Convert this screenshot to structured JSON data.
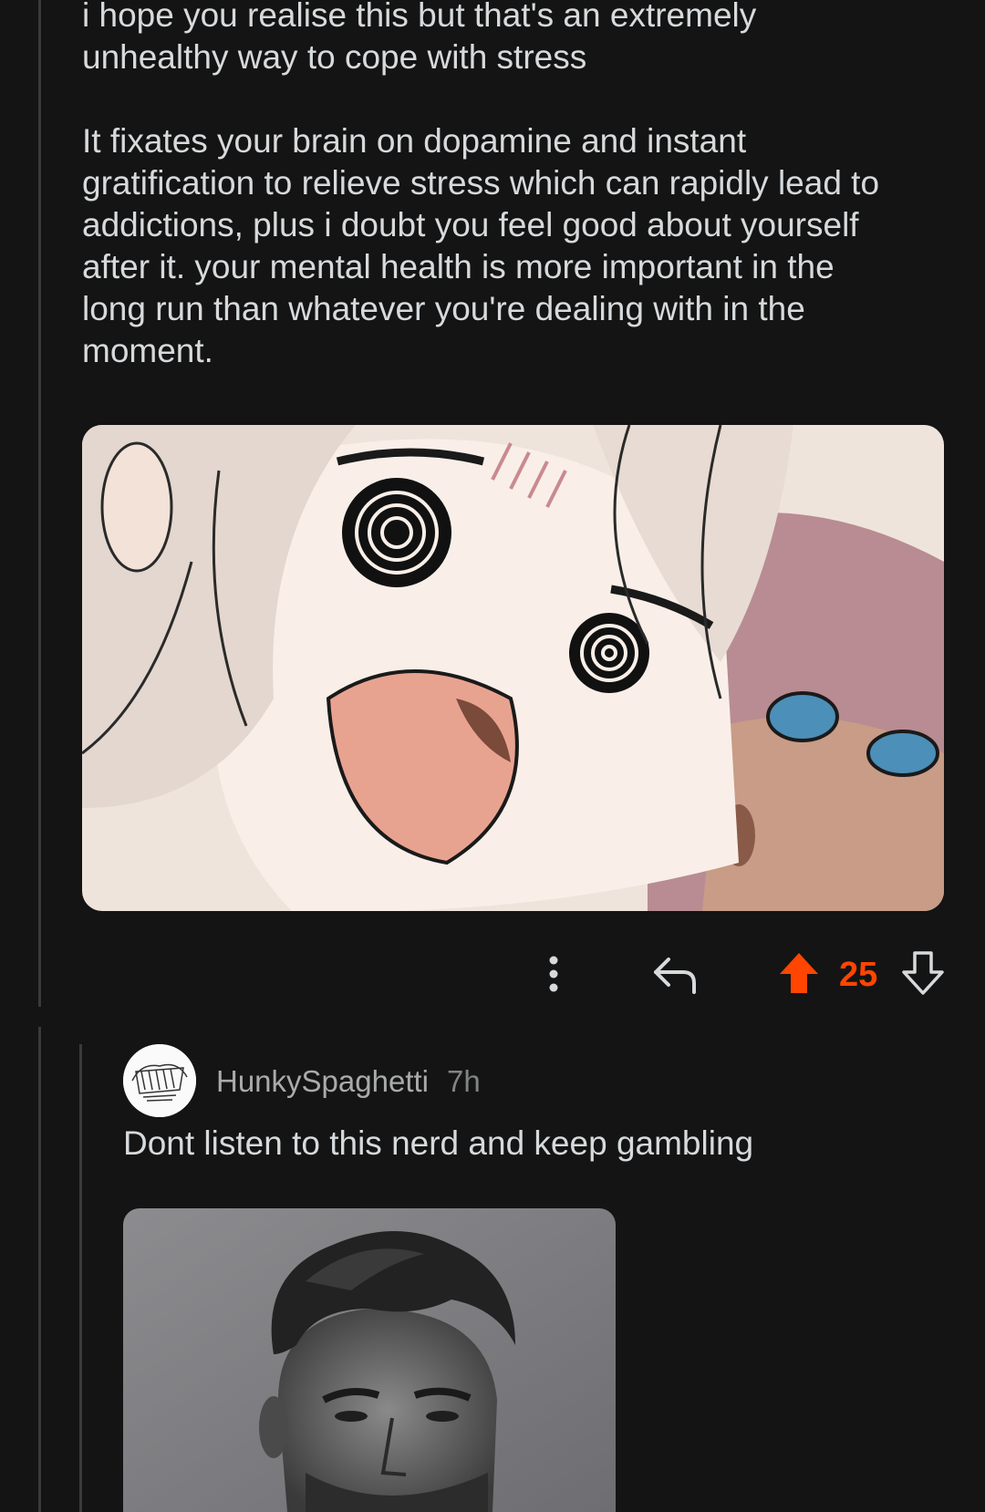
{
  "comment": {
    "paragraph_1": "i hope you realise this but that's an extremely\nunhealthy way to cope with stress",
    "paragraph_2": "It fixates your brain on dopamine and instant\ngratification to relieve stress which can rapidly lead to\naddictions, plus i doubt you feel good about yourself\nafter it. your mental health is more important in the\nlong run than whatever you're dealing with in the\nmoment.",
    "media_icon": "anime-reaction-image"
  },
  "actions": {
    "more_icon": "vertical-ellipsis-icon",
    "reply_icon": "reply-arrow-icon",
    "upvote_icon": "upvote-arrow-icon",
    "downvote_icon": "downvote-arrow-icon",
    "vote_count": "25",
    "upvoted_color": "#ff4500"
  },
  "reply": {
    "username": "HunkySpaghetti",
    "timestamp": "7h",
    "text": "Dont listen to this nerd and keep gambling",
    "avatar_icon": "user-avatar-sketch",
    "media_icon": "grayscale-portrait-image"
  },
  "colors": {
    "background": "#141414",
    "text": "#d7dadc",
    "muted": "#818384",
    "thread_line": "#3a3a3a"
  }
}
